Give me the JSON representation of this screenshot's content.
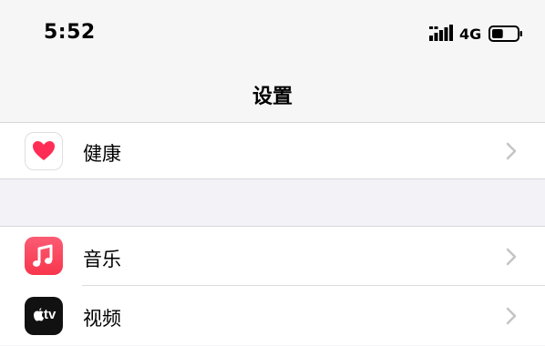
{
  "status_bar": {
    "time": "5:52",
    "network": "4G",
    "signal_icon": "cellular-signal-icon",
    "battery_icon": "battery-icon",
    "battery_level": 0.45
  },
  "nav": {
    "title": "设置"
  },
  "settings": {
    "group1": [
      {
        "label": "健康",
        "icon": "health-heart-icon",
        "icon_color": "#ff2d55"
      }
    ],
    "group2": [
      {
        "label": "音乐",
        "icon": "music-note-icon",
        "icon_color": "#fa3b52"
      },
      {
        "label": "视频",
        "icon": "apple-tv-icon",
        "icon_color": "#111111",
        "icon_text": "tv"
      }
    ]
  },
  "colors": {
    "background": "#f2f2f7",
    "separator": "#d7d7dc",
    "chevron": "#c4c4c7"
  }
}
